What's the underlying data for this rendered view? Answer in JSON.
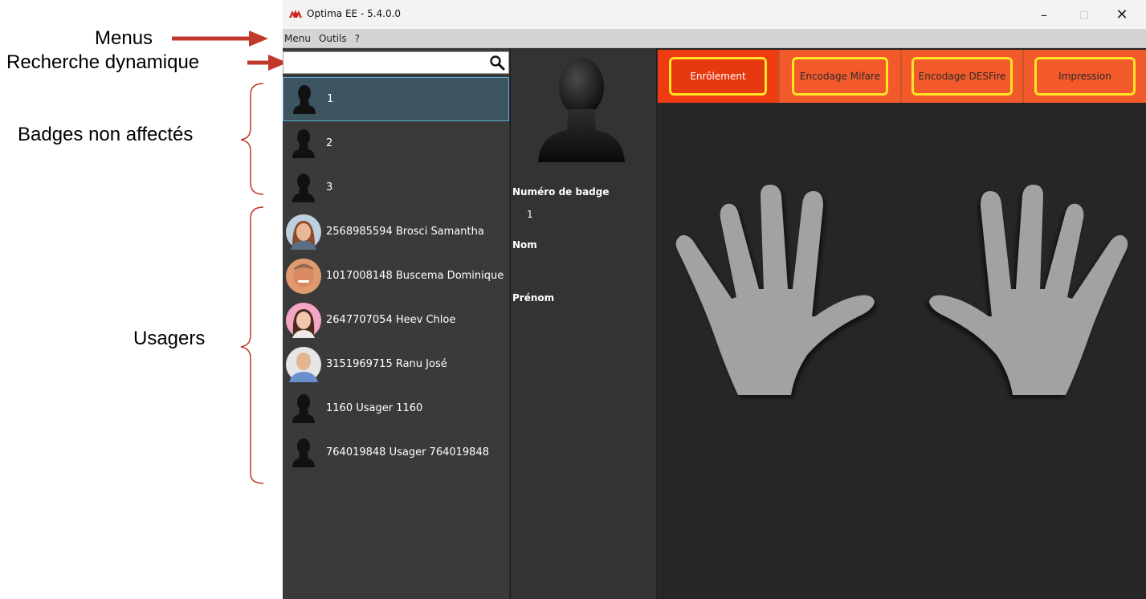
{
  "annotations": {
    "menus": "Menus",
    "recherche": "Recherche dynamique",
    "badges": "Badges non affectés",
    "usagers": "Usagers"
  },
  "window": {
    "title": "Optima EE - 5.4.0.0",
    "controls": {
      "minimize": "–",
      "maximize": "□",
      "close": "✕"
    }
  },
  "menubar": {
    "items": [
      "Menu",
      "Outils",
      "?"
    ]
  },
  "search": {
    "value": "",
    "placeholder": ""
  },
  "list": {
    "items": [
      {
        "label": "1",
        "avatar": "silhouette",
        "selected": true
      },
      {
        "label": "2",
        "avatar": "silhouette"
      },
      {
        "label": "3",
        "avatar": "silhouette"
      },
      {
        "label": "2568985594  Brosci  Samantha",
        "avatar": "photo"
      },
      {
        "label": "1017008148  Buscema  Dominique",
        "avatar": "photo"
      },
      {
        "label": "2647707054  Heev  Chloe",
        "avatar": "photo"
      },
      {
        "label": "3151969715  Ranu  José",
        "avatar": "photo"
      },
      {
        "label": "1160  Usager  1160",
        "avatar": "silhouette"
      },
      {
        "label": "764019848  Usager  764019848",
        "avatar": "silhouette"
      }
    ]
  },
  "detail": {
    "badge_label": "Numéro de badge",
    "badge_value": "1",
    "nom_label": "Nom",
    "nom_value": "",
    "prenom_label": "Prénom",
    "prenom_value": ""
  },
  "tabs": [
    "Enrôlement",
    "Encodage Mifare",
    "Encodage DESFire",
    "Impression"
  ],
  "colors": {
    "tab_bg": "#f25a2b",
    "tab_active": "#e8380f",
    "tab_outline": "#ffe326",
    "selection": "#3c5560",
    "annotation_arrow": "#c0392b"
  }
}
